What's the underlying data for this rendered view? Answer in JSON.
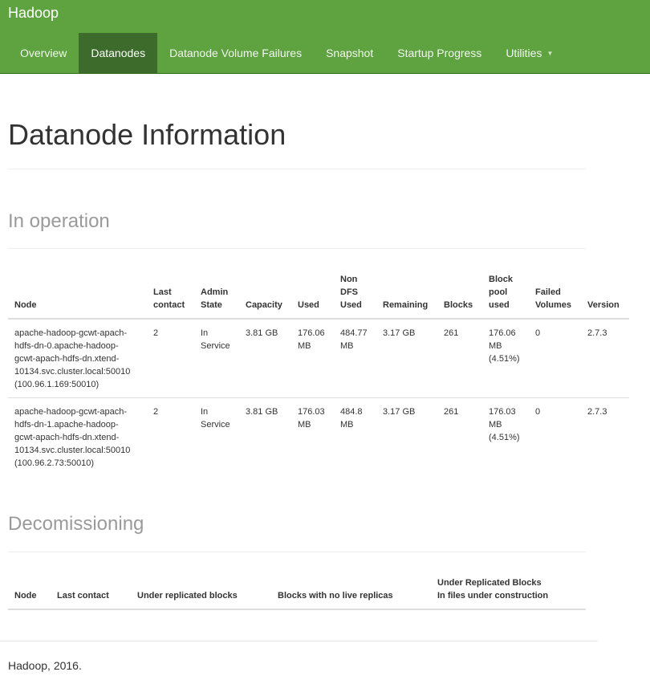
{
  "navbar": {
    "brand": "Hadoop",
    "items": [
      {
        "label": "Overview"
      },
      {
        "label": "Datanodes"
      },
      {
        "label": "Datanode Volume Failures"
      },
      {
        "label": "Snapshot"
      },
      {
        "label": "Startup Progress"
      },
      {
        "label": "Utilities"
      }
    ],
    "active": "Datanodes"
  },
  "page": {
    "title": "Datanode Information"
  },
  "in_operation": {
    "title": "In operation",
    "headers": {
      "node": "Node",
      "last_contact": [
        "Last",
        "contact"
      ],
      "admin_state": [
        "Admin",
        "State"
      ],
      "capacity": "Capacity",
      "used": "Used",
      "non_dfs_used": [
        "Non",
        "DFS",
        "Used"
      ],
      "remaining": "Remaining",
      "blocks": "Blocks",
      "block_pool_used": [
        "Block",
        "pool",
        "used"
      ],
      "failed_volumes": [
        "Failed",
        "Volumes"
      ],
      "version": "Version"
    },
    "rows": [
      {
        "node": [
          "apache-hadoop-gcwt-apach-",
          "hdfs-dn-0.apache-hadoop-",
          "gcwt-apach-hdfs-dn.xtend-",
          "10134.svc.cluster.local:50010",
          "(100.96.1.169:50010)"
        ],
        "last_contact": "2",
        "admin_state": [
          "In",
          "Service"
        ],
        "capacity": "3.81 GB",
        "used": [
          "176.06",
          "MB"
        ],
        "non_dfs_used": [
          "484.77",
          "MB"
        ],
        "remaining": "3.17 GB",
        "blocks": "261",
        "block_pool_used": [
          "176.06",
          "MB",
          "(4.51%)"
        ],
        "failed_volumes": "0",
        "version": "2.7.3"
      },
      {
        "node": [
          "apache-hadoop-gcwt-apach-",
          "hdfs-dn-1.apache-hadoop-",
          "gcwt-apach-hdfs-dn.xtend-",
          "10134.svc.cluster.local:50010",
          "(100.96.2.73:50010)"
        ],
        "last_contact": "2",
        "admin_state": [
          "In",
          "Service"
        ],
        "capacity": "3.81 GB",
        "used": [
          "176.03",
          "MB"
        ],
        "non_dfs_used": [
          "484.8",
          "MB"
        ],
        "remaining": "3.17 GB",
        "blocks": "261",
        "block_pool_used": [
          "176.03",
          "MB",
          "(4.51%)"
        ],
        "failed_volumes": "0",
        "version": "2.7.3"
      }
    ]
  },
  "decommissioning": {
    "title": "Decomissioning",
    "headers": {
      "node": "Node",
      "last_contact": "Last contact",
      "under_replicated": "Under replicated blocks",
      "no_live_replicas": "Blocks with no live replicas",
      "under_construction": [
        "Under Replicated Blocks",
        "In files under construction"
      ]
    }
  },
  "footer": {
    "text": "Hadoop, 2016."
  }
}
